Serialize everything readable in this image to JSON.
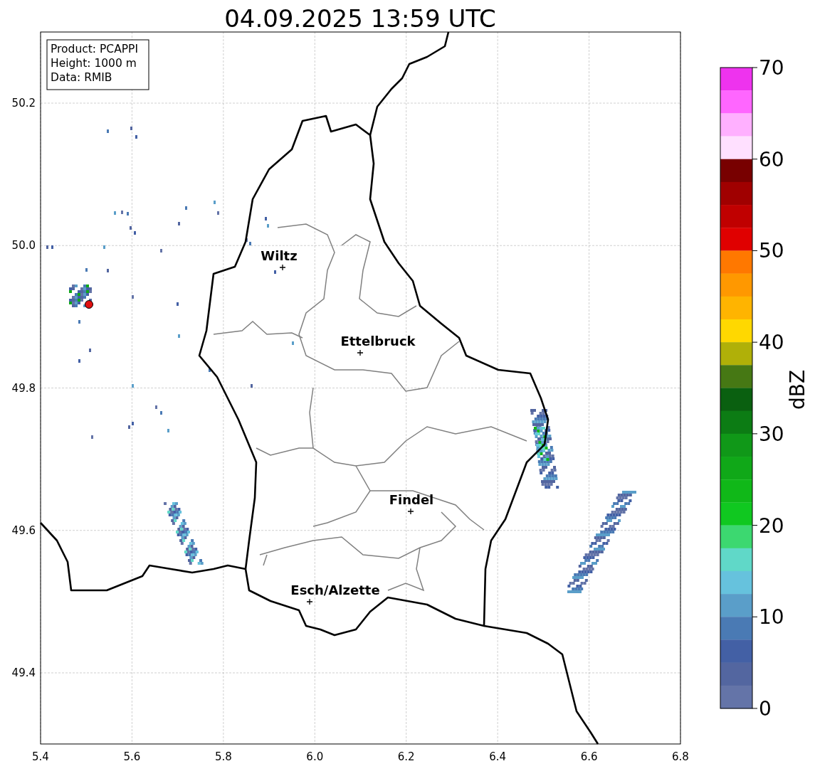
{
  "title": "04.09.2025 13:59 UTC",
  "info_box": [
    "Product: PCAPPI",
    "Height: 1000 m",
    "Data: RMIB"
  ],
  "map": {
    "xticks": [
      "5.4",
      "5.6",
      "5.8",
      "6.0",
      "6.2",
      "6.4",
      "6.6",
      "6.8"
    ],
    "yticks": [
      "50.2",
      "50.0",
      "49.8",
      "49.6",
      "49.4"
    ],
    "cities": [
      {
        "name": "Wiltz"
      },
      {
        "name": "Ettelbruck"
      },
      {
        "name": "Findel"
      },
      {
        "name": "Esch/Alzette"
      }
    ]
  },
  "colorbar": {
    "label": "dBZ",
    "ticks": [
      "70",
      "60",
      "50",
      "40",
      "30",
      "20",
      "10",
      "0"
    ],
    "bins": [
      {
        "color": "#ee33ee"
      },
      {
        "color": "#ff66ff"
      },
      {
        "color": "#ffb0ff"
      },
      {
        "color": "#ffe0ff"
      },
      {
        "color": "#780000"
      },
      {
        "color": "#a00000"
      },
      {
        "color": "#c00000"
      },
      {
        "color": "#e00000"
      },
      {
        "color": "#ff7800"
      },
      {
        "color": "#ff9800"
      },
      {
        "color": "#ffb400"
      },
      {
        "color": "#ffd800"
      },
      {
        "color": "#b0b008"
      },
      {
        "color": "#467814"
      },
      {
        "color": "#0a6010"
      },
      {
        "color": "#0c7c14"
      },
      {
        "color": "#109818"
      },
      {
        "color": "#10a818"
      },
      {
        "color": "#10b818"
      },
      {
        "color": "#10c820"
      },
      {
        "color": "#3cd870"
      },
      {
        "color": "#60d8c8"
      },
      {
        "color": "#66c2dd"
      },
      {
        "color": "#5a9ec9"
      },
      {
        "color": "#4a7ab4"
      },
      {
        "color": "#4360a5"
      },
      {
        "color": "#5366a0"
      },
      {
        "color": "#6474a8"
      }
    ]
  }
}
